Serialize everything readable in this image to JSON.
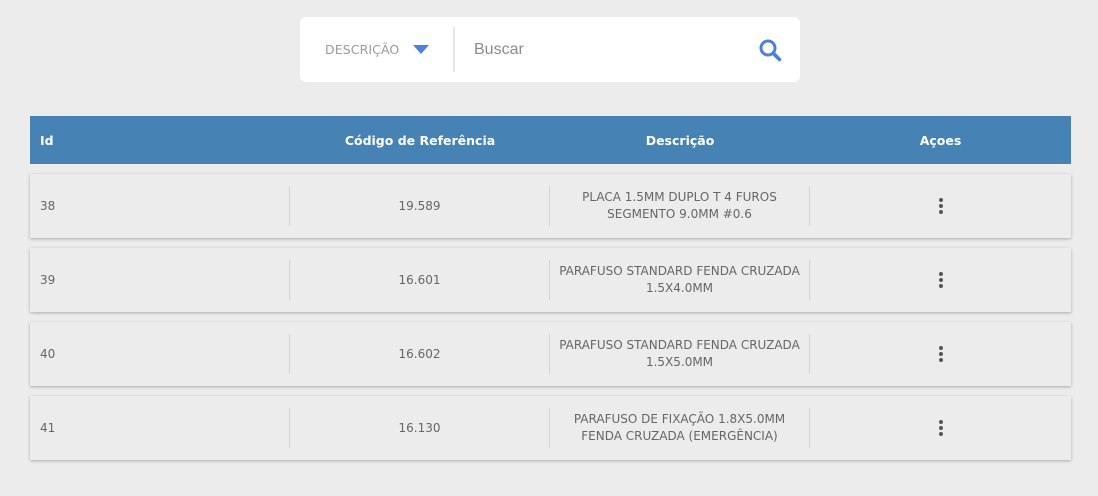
{
  "search": {
    "filter_label": "DESCRIÇÃO",
    "placeholder": "Buscar",
    "value": "",
    "accent": "#4f80d8"
  },
  "table": {
    "header_color": "#4682b4",
    "columns": [
      "Id",
      "Código de Referência",
      "Descrição",
      "Açoes"
    ],
    "rows": [
      {
        "id": "38",
        "code": "19.589",
        "desc": "PLACA 1.5MM DUPLO T 4 FUROS SEGMENTO 9.0MM #0.6",
        "actions_icon": "more-vertical-icon"
      },
      {
        "id": "39",
        "code": "16.601",
        "desc": "PARAFUSO STANDARD FENDA CRUZADA 1.5X4.0MM",
        "actions_icon": "more-vertical-icon"
      },
      {
        "id": "40",
        "code": "16.602",
        "desc": "PARAFUSO STANDARD FENDA CRUZADA 1.5X5.0MM",
        "actions_icon": "more-vertical-icon"
      },
      {
        "id": "41",
        "code": "16.130",
        "desc": "PARAFUSO DE FIXAÇÃO 1.8X5.0MM FENDA CRUZADA (EMERGÊNCIA)",
        "actions_icon": "more-vertical-icon"
      }
    ]
  }
}
